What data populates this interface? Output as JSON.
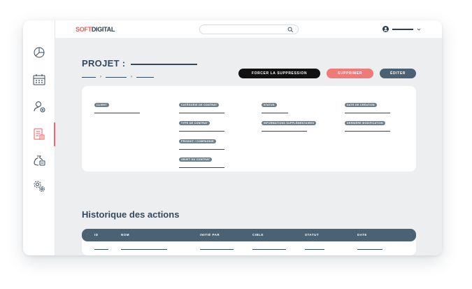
{
  "brand": {
    "part1": "SOFT",
    "part2": "DIGITAL"
  },
  "search": {
    "placeholder": ""
  },
  "sidebar": {
    "items": [
      {
        "name": "dashboard",
        "icon": "pie-chart-icon"
      },
      {
        "name": "calendar",
        "icon": "calendar-icon"
      },
      {
        "name": "users",
        "icon": "user-add-icon"
      },
      {
        "name": "projects",
        "icon": "document-icon",
        "active": true
      },
      {
        "name": "finance",
        "icon": "money-bag-icon"
      },
      {
        "name": "settings",
        "icon": "gears-icon"
      }
    ]
  },
  "page": {
    "title": "PROJET :",
    "buttons": {
      "force_delete": "FORCER LA SUPPRESSION",
      "delete": "SUPPRIMER",
      "edit": "ÉDITER"
    }
  },
  "details": {
    "client": "CLIENT",
    "contract_category": "CATÉGORIE DE CONTRAT",
    "contract_type": "TYPE DE CONTRAT",
    "product_company": "PRODUIT / COMPAGNIE",
    "contract_object": "OBJET DU CONTRAT",
    "status": "STATUS",
    "additional_info": "INFORMATIONS SUPPLÉMENTAIRES",
    "creation_date": "DATE DE CRÉATION",
    "last_modification": "DERNIÈRE MODIFICATION"
  },
  "history": {
    "title": "Historique des actions",
    "columns": [
      "ID",
      "NOM",
      "INITIÉ PAR",
      "CIBLE",
      "STATUT",
      "DATE"
    ]
  },
  "colors": {
    "accent": "#ef5b57",
    "dark": "#34495e",
    "header": "#4a6274",
    "pill": "#6d7f8e"
  }
}
